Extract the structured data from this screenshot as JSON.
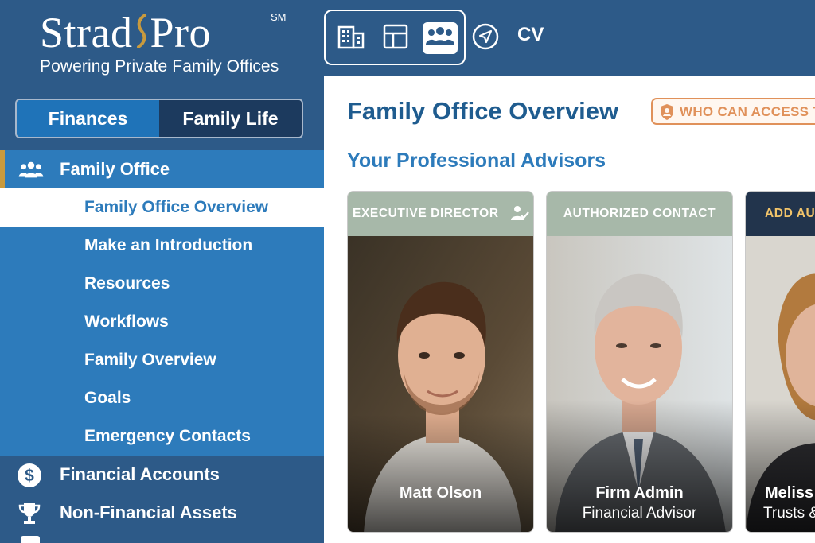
{
  "brand": {
    "name_left": "Strad",
    "name_right": "Pro",
    "sm": "SM",
    "tagline": "Powering Private Family Offices"
  },
  "topbar": {
    "modes": [
      {
        "icon": "building-icon",
        "active": false
      },
      {
        "icon": "layout-icon",
        "active": false
      },
      {
        "icon": "people-icon",
        "active": true
      }
    ],
    "nav_icon": "navigation-arrow-icon",
    "user_initials": "CV"
  },
  "sidebar": {
    "segments": [
      "Finances",
      "Family Life"
    ],
    "active_segment": "Finances",
    "sections": [
      {
        "label": "Family Office",
        "icon": "people-icon"
      },
      {
        "label": "Financial Accounts",
        "icon": "dollar-circle-icon"
      },
      {
        "label": "Non-Financial Assets",
        "icon": "trophy-icon"
      }
    ],
    "sub_items": [
      "Family Office Overview",
      "Make an Introduction",
      "Resources",
      "Workflows",
      "Family Overview",
      "Goals",
      "Emergency Contacts"
    ],
    "current_sub_item": "Family Office Overview"
  },
  "main": {
    "title": "Family Office Overview",
    "access_badge": "WHO CAN ACCESS TH",
    "section_title": "Your Professional Advisors",
    "cards": [
      {
        "role": "EXECUTIVE DIRECTOR",
        "name": "Matt Olson",
        "subtitle": ""
      },
      {
        "role": "AUTHORIZED CONTACT",
        "name": "Firm Admin",
        "subtitle": "Financial Advisor"
      },
      {
        "role": "ADD AU",
        "name": "Meliss",
        "subtitle": "Trusts &"
      }
    ]
  },
  "colors": {
    "brand_blue": "#2d5a88",
    "nav_blue": "#2d7bbb",
    "accent_gold": "#c89a3e",
    "badge_orange": "#e0915a",
    "card_head_sage": "#a7b8a9"
  }
}
